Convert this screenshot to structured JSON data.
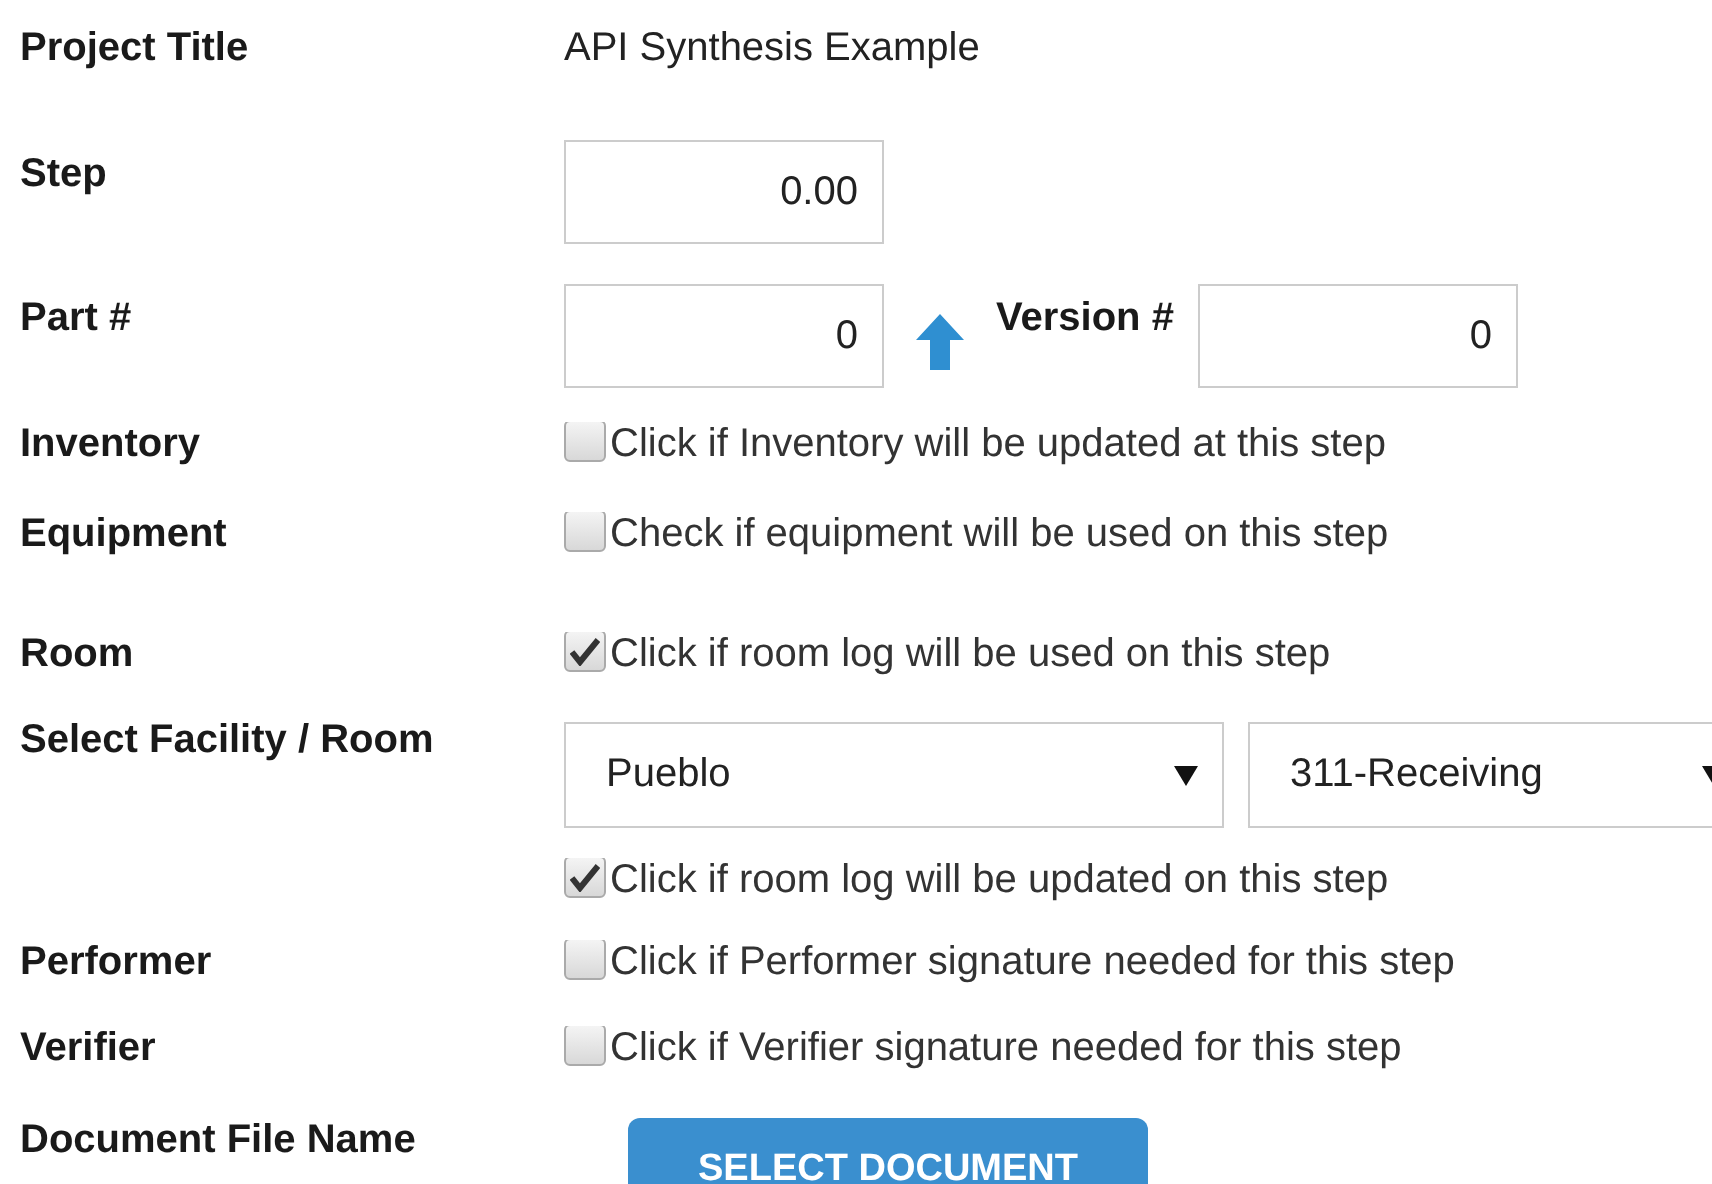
{
  "rows": [
    {
      "kind": "text",
      "label": "Project Title",
      "value": "API Synthesis Example"
    },
    {
      "kind": "number",
      "label": "Step",
      "value": "0.00"
    },
    {
      "kind": "number_pair",
      "label": "Part #",
      "value": "0",
      "second_label": "Version #",
      "second_value": "0"
    },
    {
      "kind": "checkbox",
      "label": "Inventory",
      "text": "Click if Inventory will be updated at this step",
      "checked": false
    },
    {
      "kind": "checkbox",
      "label": "Equipment",
      "text": "Check if equipment will be used on this step",
      "checked": false
    },
    {
      "kind": "checkbox",
      "label": "Room",
      "text": "Click if room log will be used on this step",
      "checked": true
    },
    {
      "kind": "selects",
      "label": "Select Facility / Room",
      "selects": [
        {
          "value": "Pueblo"
        },
        {
          "value": "311-Receiving"
        }
      ]
    },
    {
      "kind": "checkbox",
      "text": "Click if room log will be updated on this step",
      "checked": true
    },
    {
      "kind": "checkbox",
      "label": "Performer",
      "text": "Click if Performer signature needed for this step",
      "checked": false
    },
    {
      "kind": "checkbox",
      "label": "Verifier",
      "text": "Click if Verifier signature needed for this step",
      "checked": false
    },
    {
      "kind": "button",
      "label": "Document File Name",
      "button": "SELECT DOCUMENT"
    }
  ]
}
